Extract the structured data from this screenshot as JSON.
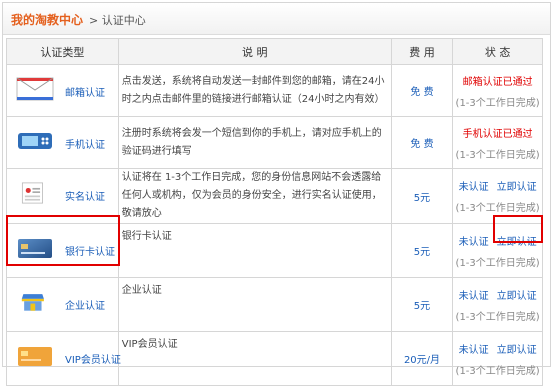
{
  "header": {
    "title": "我的淘教中心",
    "crumb": "> 认证中心"
  },
  "columns": [
    "认证类型",
    "说 明",
    "费 用",
    "状 态"
  ],
  "rows": [
    {
      "type": "邮箱认证",
      "icon": "envelope-icon",
      "desc": "点击发送，系统将自动发送一封邮件到您的邮箱，请在24小时之内点击邮件里的链接进行邮箱认证（24小时之内有效）",
      "fee": "免 费",
      "status": "邮箱认证已通过",
      "hint": "(1-3个工作日完成)"
    },
    {
      "type": "手机认证",
      "icon": "phone-icon",
      "desc": "注册时系统将会发一个短信到你的手机上，请对应手机上的验证码进行填写",
      "fee": "免 费",
      "status": "手机认证已通过",
      "hint": "(1-3个工作日完成)"
    },
    {
      "type": "实名认证",
      "icon": "id-card-icon",
      "desc": "认证将在 1-3个工作日完成，您的身份信息网站不会透露给任何人或机构，仅为会员的身份安全，进行实名认证使用，敬请放心",
      "fee": "5元",
      "not": "未认证",
      "go": "立即认证",
      "hint": "(1-3个工作日完成)"
    },
    {
      "type": "银行卡认证",
      "icon": "bank-card-icon",
      "desc": "银行卡认证",
      "fee": "5元",
      "not": "未认证",
      "go": "立即认证",
      "hint": "(1-3个工作日完成)"
    },
    {
      "type": "企业认证",
      "icon": "storefront-icon",
      "desc": "企业认证",
      "fee": "5元",
      "not": "未认证",
      "go": "立即认证",
      "hint": "(1-3个工作日完成)"
    },
    {
      "type": "VIP会员认证",
      "icon": "vip-card-icon",
      "desc": "VIP会员认证",
      "fee": "20元/月",
      "not": "未认证",
      "go": "立即认证",
      "hint": "(1-3个工作日完成)"
    }
  ],
  "colors": {
    "accent": "#e4601e",
    "link": "#1b5eb8",
    "passed": "#e00000",
    "highlight": "#e10000"
  }
}
